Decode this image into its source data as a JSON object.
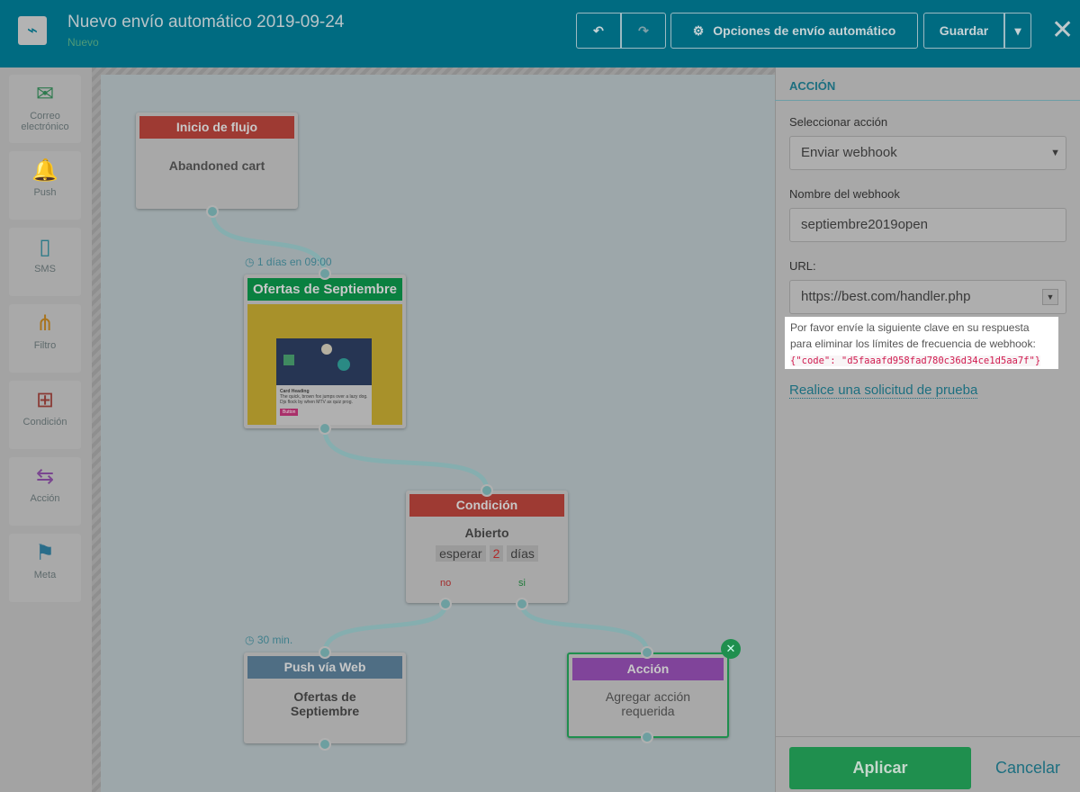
{
  "header": {
    "title": "Nuevo envío automático 2019-09-24",
    "status": "Nuevo",
    "undo": "↶",
    "redo": "↷",
    "options_label": "Opciones de envío automático",
    "save_label": "Guardar",
    "close": "✕"
  },
  "sidebar": {
    "items": [
      {
        "label": "Correo electrónico",
        "icon": "✉"
      },
      {
        "label": "Push",
        "icon": "🔔"
      },
      {
        "label": "SMS",
        "icon": "▯"
      },
      {
        "label": "Filtro",
        "icon": "⋔"
      },
      {
        "label": "Condición",
        "icon": "⊞"
      },
      {
        "label": "Acción",
        "icon": "⇆"
      },
      {
        "label": "Meta",
        "icon": "⚑"
      }
    ]
  },
  "flow": {
    "start": {
      "title": "Inicio de flujo",
      "body": "Abandoned cart"
    },
    "delay1": "1 días en 09:00",
    "email": {
      "title": "Ofertas de Septiembre",
      "card_heading": "Card Heading",
      "card_text": "The quick, brown fox jumps over a lazy dog. Djs flock by when MTV ax quiz prog.",
      "card_button": "Button"
    },
    "condition": {
      "title": "Condición",
      "body": "Abierto",
      "wait": "esperar",
      "days_value": "2",
      "days": "días",
      "no": "no",
      "yes": "si"
    },
    "delay2": "30 min.",
    "push": {
      "title": "Push vía Web",
      "body": "Ofertas de Septiembre"
    },
    "action": {
      "title": "Acción",
      "body": "Agregar acción requerida"
    }
  },
  "panel": {
    "section": "ACCIÓN",
    "select_label": "Seleccionar acción",
    "select_value": "Enviar webhook",
    "name_label": "Nombre del webhook",
    "name_value": "septiembre2019open",
    "url_label": "URL:",
    "url_value": "https://best.com/handler.php",
    "hint": "Por favor envíe la siguiente clave en su respuesta para eliminar los límites de frecuencia de webhook:",
    "code": "{\"code\": \"d5faaafd958fad780c36d34ce1d5aa7f\"}",
    "test_link": "Realice una solicitud de prueba",
    "apply": "Aplicar",
    "cancel": "Cancelar"
  },
  "colors": {
    "header": "#006b81",
    "start": "#9e3a33",
    "email": "#0a8040",
    "push": "#4f6e84",
    "action": "#80449a",
    "apply": "#1f8f4e"
  }
}
